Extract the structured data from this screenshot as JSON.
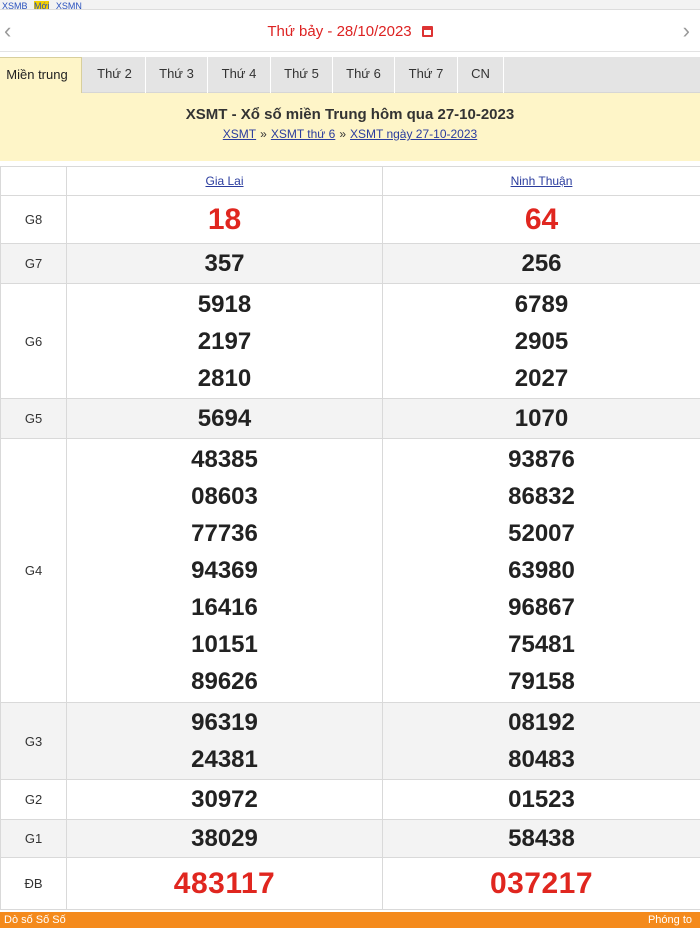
{
  "topstrip": {
    "a": "XSMB",
    "b": "Mới",
    "c": "XSMN"
  },
  "datebar": {
    "text": "Thứ bảy -  28/10/2023",
    "prev": "‹",
    "next": "›"
  },
  "tabs": [
    {
      "label": "Miền trung",
      "active": true
    },
    {
      "label": "Thứ 2"
    },
    {
      "label": "Thứ 3"
    },
    {
      "label": "Thứ 4"
    },
    {
      "label": "Thứ 5"
    },
    {
      "label": "Thứ 6"
    },
    {
      "label": "Thứ 7"
    },
    {
      "label": "CN"
    }
  ],
  "banner": {
    "title": "XSMT - Xổ số miền Trung hôm qua 27-10-2023",
    "crumbs": [
      "XSMT",
      "XSMT thứ 6",
      "XSMT ngày 27-10-2023"
    ],
    "sep": "»"
  },
  "table": {
    "provinces": [
      "Gia Lai",
      "Ninh Thuận"
    ],
    "rows": [
      {
        "label": "G8",
        "a": [
          "18"
        ],
        "b": [
          "64"
        ],
        "style": "red"
      },
      {
        "label": "G7",
        "a": [
          "357"
        ],
        "b": [
          "256"
        ]
      },
      {
        "label": "G6",
        "a": [
          "5918",
          "2197",
          "2810"
        ],
        "b": [
          "6789",
          "2905",
          "2027"
        ]
      },
      {
        "label": "G5",
        "a": [
          "5694"
        ],
        "b": [
          "1070"
        ]
      },
      {
        "label": "G4",
        "a": [
          "48385",
          "08603",
          "77736",
          "94369",
          "16416",
          "10151",
          "89626"
        ],
        "b": [
          "93876",
          "86832",
          "52007",
          "63980",
          "96867",
          "75481",
          "79158"
        ]
      },
      {
        "label": "G3",
        "a": [
          "96319",
          "24381"
        ],
        "b": [
          "08192",
          "80483"
        ]
      },
      {
        "label": "G2",
        "a": [
          "30972"
        ],
        "b": [
          "01523"
        ]
      },
      {
        "label": "G1",
        "a": [
          "38029"
        ],
        "b": [
          "58438"
        ]
      },
      {
        "label": "ĐB",
        "a": [
          "483117"
        ],
        "b": [
          "037217"
        ],
        "style": "big"
      }
    ]
  },
  "footer": {
    "left": "Dò số  Số  Số",
    "right": "Phóng to"
  }
}
